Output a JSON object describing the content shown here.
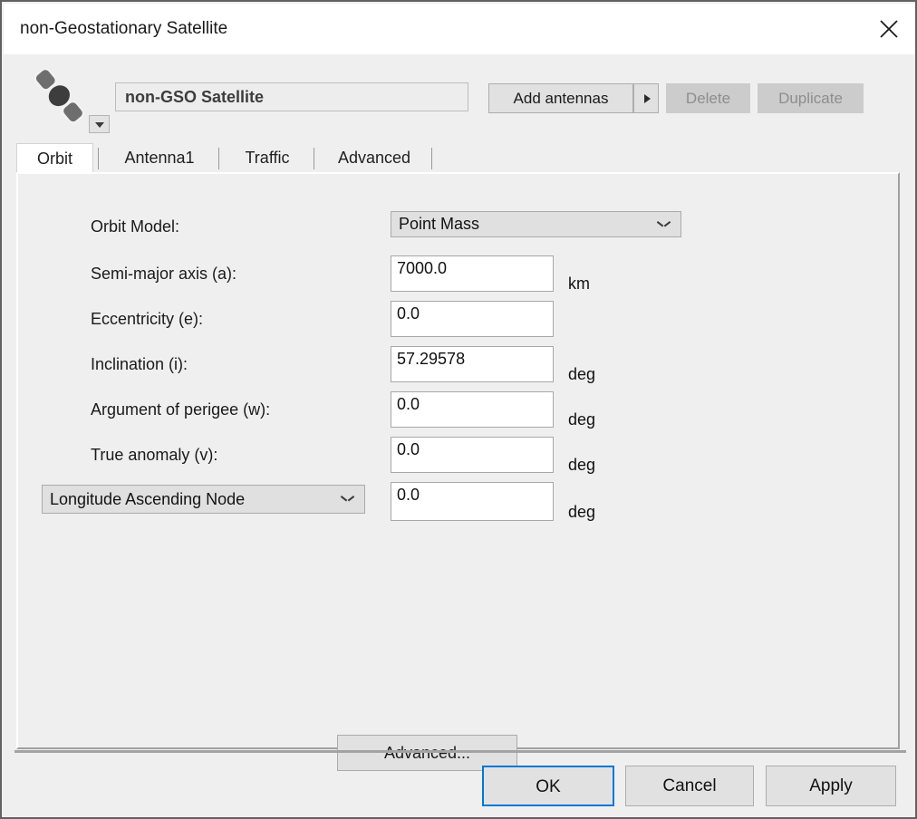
{
  "window": {
    "title": "non-Geostationary Satellite",
    "close_icon": "close-icon"
  },
  "header": {
    "satellite_icon": "satellite-icon",
    "name_value": "non-GSO Satellite",
    "name_dropdown_icon": "triangle-down-icon",
    "add_antennas_label": "Add antennas",
    "add_antennas_arrow_icon": "triangle-right-icon",
    "delete_label": "Delete",
    "duplicate_label": "Duplicate"
  },
  "tabs": [
    {
      "label": "Orbit",
      "selected": true
    },
    {
      "label": "Antenna1",
      "selected": false
    },
    {
      "label": "Traffic",
      "selected": false
    },
    {
      "label": "Advanced",
      "selected": false
    }
  ],
  "orbit_form": {
    "orbit_model": {
      "label": "Orbit Model:",
      "value": "Point Mass",
      "chevron_icon": "chevron-down-icon"
    },
    "semi_major_axis": {
      "label": "Semi-major axis (a):",
      "value": "7000.0",
      "unit": "km"
    },
    "eccentricity": {
      "label": "Eccentricity (e):",
      "value": "0.0",
      "unit": ""
    },
    "inclination": {
      "label": "Inclination (i):",
      "value": "57.29578",
      "unit": "deg"
    },
    "argument_of_perigee": {
      "label": "Argument of perigee (w):",
      "value": "0.0",
      "unit": "deg"
    },
    "true_anomaly": {
      "label": "True anomaly (v):",
      "value": "0.0",
      "unit": "deg"
    },
    "node": {
      "selector_value": "Longitude Ascending Node",
      "chevron_icon": "chevron-down-icon",
      "value": "0.0",
      "unit": "deg"
    },
    "advanced_button_label": "Advanced..."
  },
  "footer": {
    "ok_label": "OK",
    "cancel_label": "Cancel",
    "apply_label": "Apply"
  },
  "colors": {
    "window_bg": "#efefef",
    "titlebar_bg": "#ffffff",
    "focus_blue": "#0078d7",
    "disabled_text": "#8d8d8d"
  }
}
